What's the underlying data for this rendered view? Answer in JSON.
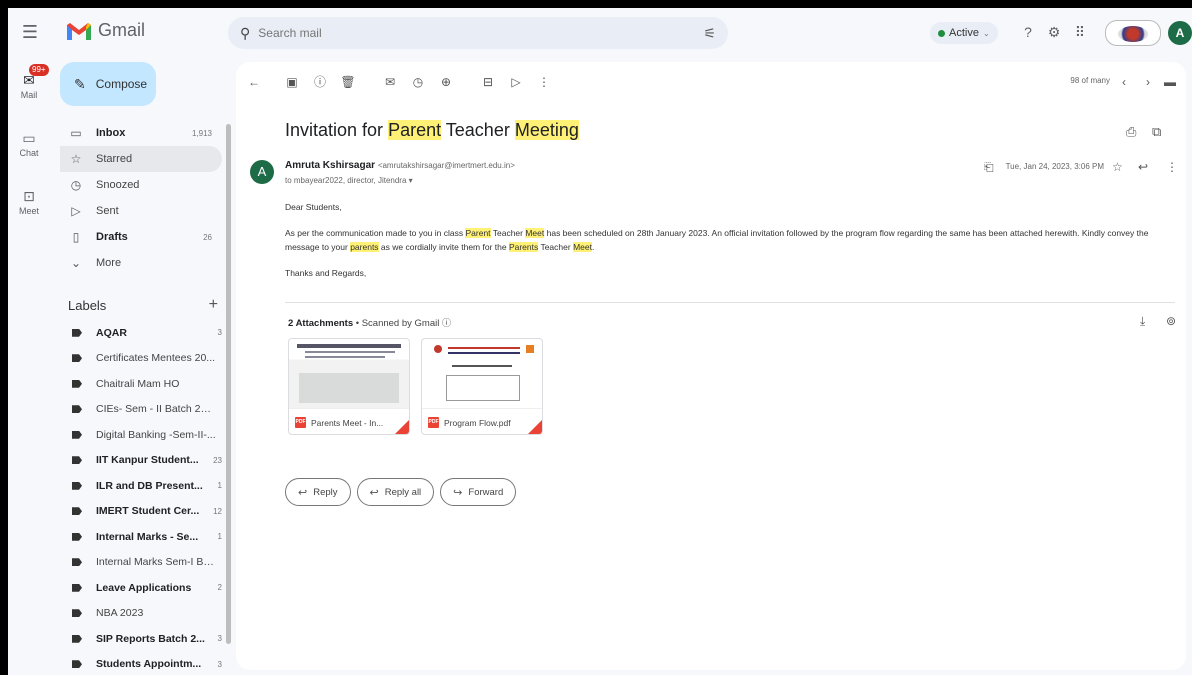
{
  "app": {
    "name": "Gmail"
  },
  "search": {
    "placeholder": "Search mail"
  },
  "status": {
    "label": "Active"
  },
  "user": {
    "initial": "A"
  },
  "rail": [
    {
      "label": "Mail",
      "badge": "99+"
    },
    {
      "label": "Chat"
    },
    {
      "label": "Meet"
    }
  ],
  "compose": {
    "label": "Compose"
  },
  "nav": [
    {
      "label": "Inbox",
      "count": "1,913"
    },
    {
      "label": "Starred",
      "count": ""
    },
    {
      "label": "Snoozed",
      "count": ""
    },
    {
      "label": "Sent",
      "count": ""
    },
    {
      "label": "Drafts",
      "count": "26"
    },
    {
      "label": "More",
      "count": ""
    }
  ],
  "labels_title": "Labels",
  "labels": [
    {
      "label": "AQAR",
      "count": "3",
      "bold": true
    },
    {
      "label": "Certificates Mentees 20...",
      "count": "",
      "bold": false
    },
    {
      "label": "Chaitrali Mam HO",
      "count": "",
      "bold": false
    },
    {
      "label": "CIEs- Sem - II Batch 202...",
      "count": "",
      "bold": false
    },
    {
      "label": "Digital Banking -Sem-II-...",
      "count": "",
      "bold": false
    },
    {
      "label": "IIT Kanpur Student...",
      "count": "23",
      "bold": true
    },
    {
      "label": "ILR and DB Present...",
      "count": "1",
      "bold": true
    },
    {
      "label": "IMERT Student Cer...",
      "count": "12",
      "bold": true
    },
    {
      "label": "Internal Marks - Se...",
      "count": "1",
      "bold": true
    },
    {
      "label": "Internal Marks Sem-I Bat...",
      "count": "",
      "bold": false
    },
    {
      "label": "Leave Applications",
      "count": "2",
      "bold": true
    },
    {
      "label": "NBA 2023",
      "count": "",
      "bold": false
    },
    {
      "label": "SIP Reports Batch 2...",
      "count": "3",
      "bold": true
    },
    {
      "label": "Students Appointm...",
      "count": "3",
      "bold": true
    }
  ],
  "pager": {
    "text": "98 of many"
  },
  "email": {
    "subject_parts": [
      "Invitation for ",
      "Parent",
      " Teacher ",
      "Meeting"
    ],
    "sender_name": "Amruta Kshirsagar",
    "sender_email": "<amrutakshirsagar@imertmert.edu.in>",
    "sender_initial": "A",
    "recipients": "to mbayear2022, director, Jitendra",
    "date": "Tue, Jan 24, 2023, 3:06 PM",
    "greeting": "Dear Students,",
    "body_parts": [
      "As per the communication made to you in class ",
      "Parent",
      " Teacher ",
      "Meet",
      " has been scheduled on 28th January 2023. An official invitation followed by the program flow regarding the same has been attached herewith. Kindly convey the message to your ",
      "parents",
      " as we cordially invite them for the ",
      "Parents",
      " Teacher ",
      "Meet",
      "."
    ],
    "signoff": "Thanks and Regards,"
  },
  "attachments": {
    "title": "2 Attachments",
    "scanned": " • Scanned by Gmail",
    "files": [
      {
        "name": "Parents Meet - In...",
        "type": "PDF"
      },
      {
        "name": "Program Flow.pdf",
        "type": "PDF"
      }
    ]
  },
  "actions": {
    "reply": "Reply",
    "reply_all": "Reply all",
    "forward": "Forward"
  },
  "colors": {
    "accent": "#c2e7ff",
    "highlight": "#fff176",
    "avatar": "#1e6b48",
    "badge": "#d93025"
  }
}
